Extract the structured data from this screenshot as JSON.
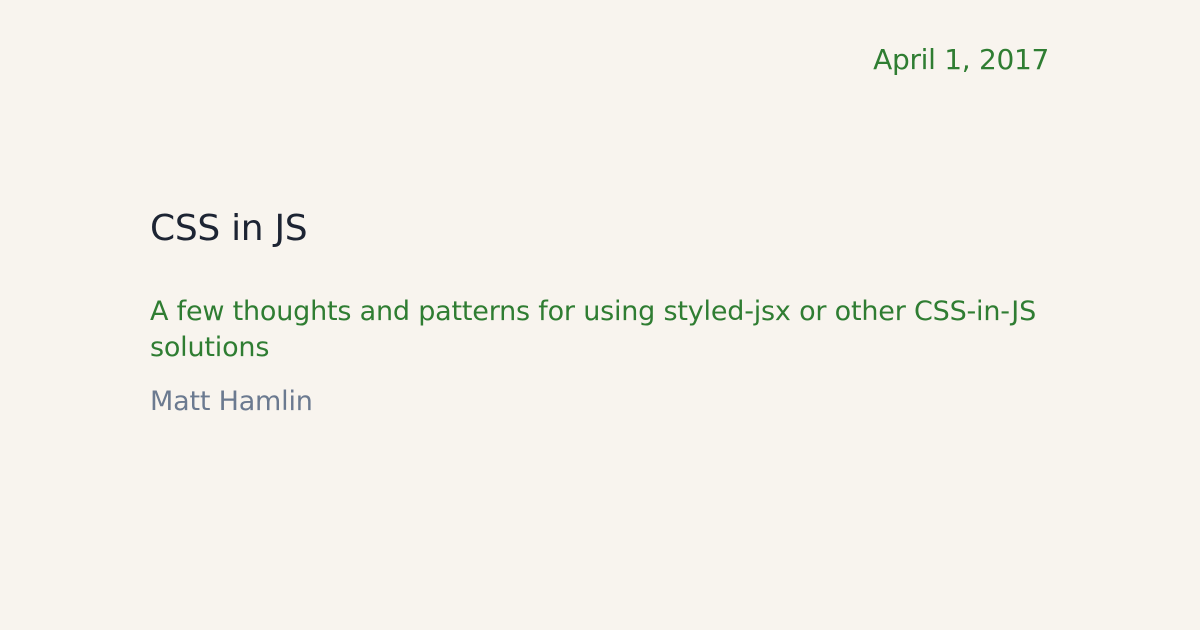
{
  "meta": {
    "date": "April 1, 2017"
  },
  "post": {
    "title": "CSS in JS",
    "description": "A few thoughts and patterns for using styled-jsx or other CSS-in-JS solutions",
    "author": "Matt Hamlin"
  },
  "colors": {
    "background": "#f8f4ee",
    "accent": "#2f7d32",
    "title": "#1d2433",
    "author": "#6b7a90"
  }
}
